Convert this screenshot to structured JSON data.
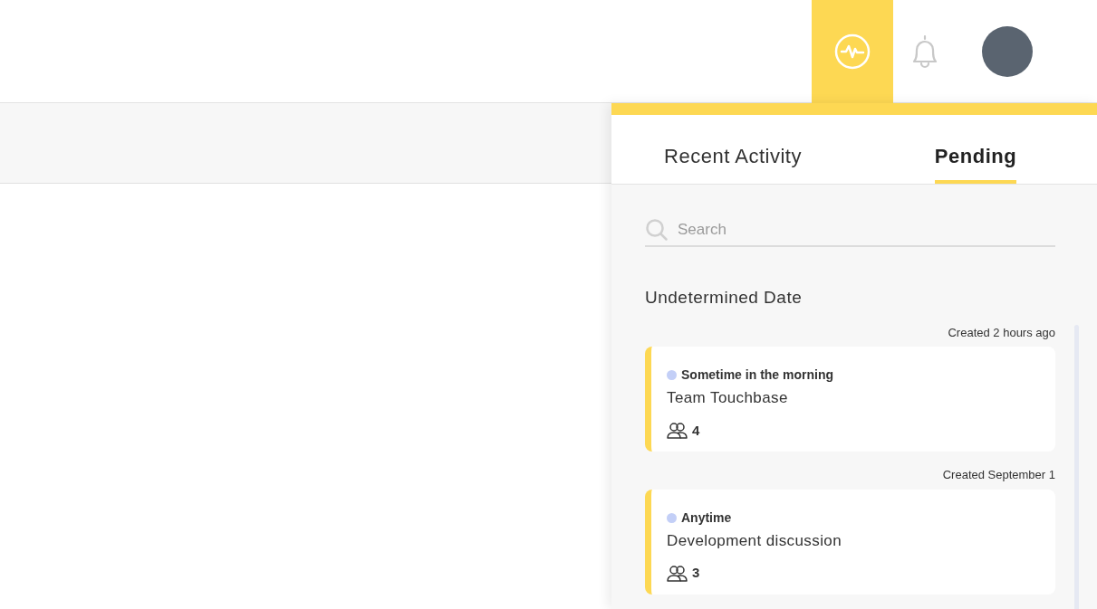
{
  "header": {
    "nav": [
      {
        "kind": "activity",
        "selected": true
      },
      {
        "kind": "bell",
        "selected": false
      }
    ]
  },
  "panel": {
    "tabs": [
      {
        "label": "Recent Activity",
        "selected": false
      },
      {
        "label": "Pending",
        "selected": true
      }
    ],
    "search": {
      "placeholder": "Search"
    },
    "section": "Undetermined Date",
    "items": [
      {
        "created": "Created 2 hours ago",
        "time": "Sometime in the morning",
        "color": "#c3cff7",
        "title": "Team Touchbase",
        "attendees": "4"
      },
      {
        "created": "Created September 1",
        "time": "Anytime",
        "color": "#c3cff7",
        "title": "Development discussion",
        "attendees": "3"
      }
    ]
  }
}
